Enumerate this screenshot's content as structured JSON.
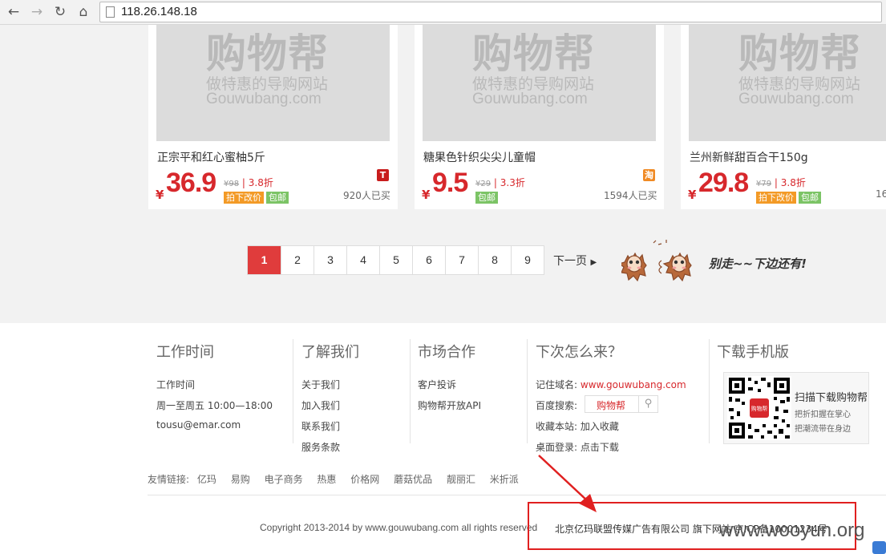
{
  "browser": {
    "url": "118.26.148.18"
  },
  "products": [
    {
      "watermark_title": "购物帮",
      "watermark_slogan": "做特惠的导购网站",
      "watermark_domain": "Gouwubang.com",
      "title": "正宗平和红心蜜柚5斤",
      "currency": "¥",
      "price": "36.9",
      "orig_price": "¥98",
      "discount": "3.8折",
      "tags": [
        "拍下改价",
        "包邮"
      ],
      "mall_badge": "T",
      "sold": "920人已买"
    },
    {
      "watermark_title": "购物帮",
      "watermark_slogan": "做特惠的导购网站",
      "watermark_domain": "Gouwubang.com",
      "title": "糖果色针织尖尖儿童帽",
      "currency": "¥",
      "price": "9.5",
      "orig_price": "¥29",
      "discount": "3.3折",
      "tags": [
        "包邮"
      ],
      "mall_badge": "淘",
      "sold": "1594人已买"
    },
    {
      "watermark_title": "购物帮",
      "watermark_slogan": "做特惠的导购网站",
      "watermark_domain": "Gouwubang.com",
      "title": "兰州新鲜甜百合干150g",
      "currency": "¥",
      "price": "29.8",
      "orig_price": "¥79",
      "discount": "3.8折",
      "tags": [
        "拍下改价",
        "包邮"
      ],
      "sold": "16"
    }
  ],
  "pagination": {
    "pages": [
      "1",
      "2",
      "3",
      "4",
      "5",
      "6",
      "7",
      "8",
      "9"
    ],
    "active": "1",
    "next_label": "下一页",
    "mascot_caption": "别走~~下边还有!"
  },
  "footer": {
    "work_time": {
      "title": "工作时间",
      "lines": [
        "工作时间",
        "周一至周五 10:00—18:00",
        "tousu@emar.com"
      ]
    },
    "about": {
      "title": "了解我们",
      "links": [
        "关于我们",
        "加入我们",
        "联系我们",
        "服务条款"
      ]
    },
    "market": {
      "title": "市场合作",
      "links": [
        "客户投诉",
        "购物帮开放API"
      ]
    },
    "next_visit": {
      "title": "下次怎么来？",
      "domain_label": "记住域名:",
      "domain_value": "www.gouwubang.com",
      "search_label": "百度搜索:",
      "search_value": "购物帮",
      "fav_label": "收藏本站:",
      "fav_link": "加入收藏",
      "desktop_label": "桌面登录:",
      "desktop_link": "点击下载"
    },
    "mobile": {
      "title": "下载手机版",
      "qr_title": "扫描下载购物帮",
      "qr_line1": "把折扣握在掌心",
      "qr_line2": "把潮流带在身边",
      "qr_center": "购物帮"
    },
    "friend_links_label": "友情链接:",
    "friend_links": [
      "亿玛",
      "易购",
      "电子商务",
      "热惠",
      "价格网",
      "蘑菇优品",
      "靓丽汇",
      "米折派"
    ],
    "copyright": "Copyright 2013-2014 by www.gouwubang.com all rights reserved",
    "company": "北京亿玛联盟传媒广告有限公司 旗下网站 京ICP备10001234号"
  },
  "overlay": {
    "watermark": "www.wooyun.org",
    "highlight_color": "#e02020"
  }
}
